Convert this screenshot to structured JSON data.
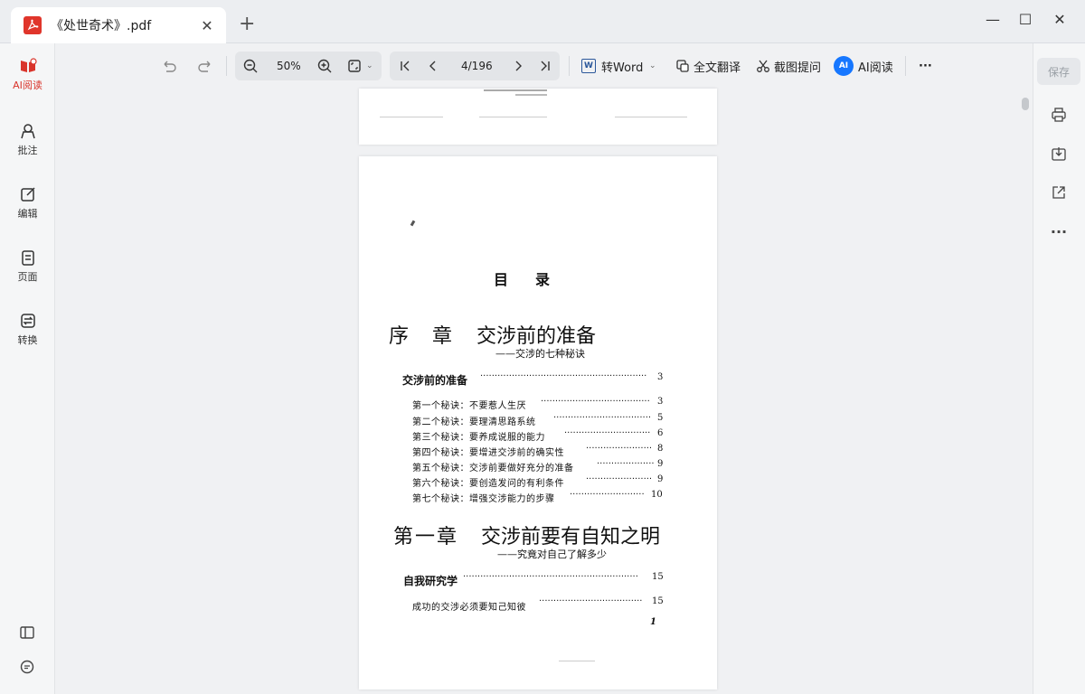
{
  "tab": {
    "title": "《处世奇术》.pdf",
    "pdf_badge": "PDF"
  },
  "left_nav": [
    {
      "label": "AI阅读",
      "icon": "ai-read-icon"
    },
    {
      "label": "批注",
      "icon": "annotate-icon"
    },
    {
      "label": "编辑",
      "icon": "edit-icon"
    },
    {
      "label": "页面",
      "icon": "pages-icon"
    },
    {
      "label": "转换",
      "icon": "convert-icon"
    }
  ],
  "toolbar": {
    "zoom": "50%",
    "page_indicator": "4/196",
    "to_word": "转Word",
    "translate": "全文翻译",
    "screenshot_ask": "截图提问",
    "ai_read": "AI阅读",
    "more": "···"
  },
  "right_panel": {
    "save": "保存"
  },
  "document": {
    "toc_title": "目录",
    "preface": {
      "title_a": "序　章",
      "title_b": "交涉前的准备",
      "subtitle": "——交涉的七种秘诀"
    },
    "preface_section": {
      "title": "交涉前的准备",
      "page": "3"
    },
    "preface_entries": [
      {
        "text": "第一个秘诀：不要惹人生厌",
        "page": "3"
      },
      {
        "text": "第二个秘诀：要理清思路系统",
        "page": "5"
      },
      {
        "text": "第三个秘诀：要养成说服的能力",
        "page": "6"
      },
      {
        "text": "第四个秘诀：要增进交涉前的确实性",
        "page": "8"
      },
      {
        "text": "第五个秘诀：交涉前要做好充分的准备",
        "page": "9"
      },
      {
        "text": "第六个秘诀：要创造发问的有利条件",
        "page": "9"
      },
      {
        "text": "第七个秘诀：增强交涉能力的步骤",
        "page": "10"
      }
    ],
    "chapter1": {
      "title_a": "第一章",
      "title_b": "交涉前要有自知之明",
      "subtitle": "——究竟对自己了解多少"
    },
    "chapter1_section": {
      "title": "自我研究学",
      "page": "15"
    },
    "chapter1_entries": [
      {
        "text": "成功的交涉必须要知己知彼",
        "page": "15"
      }
    ],
    "page_number": "1"
  },
  "colors": {
    "accent": "#d9342b",
    "ai_blue": "#1677ff"
  }
}
